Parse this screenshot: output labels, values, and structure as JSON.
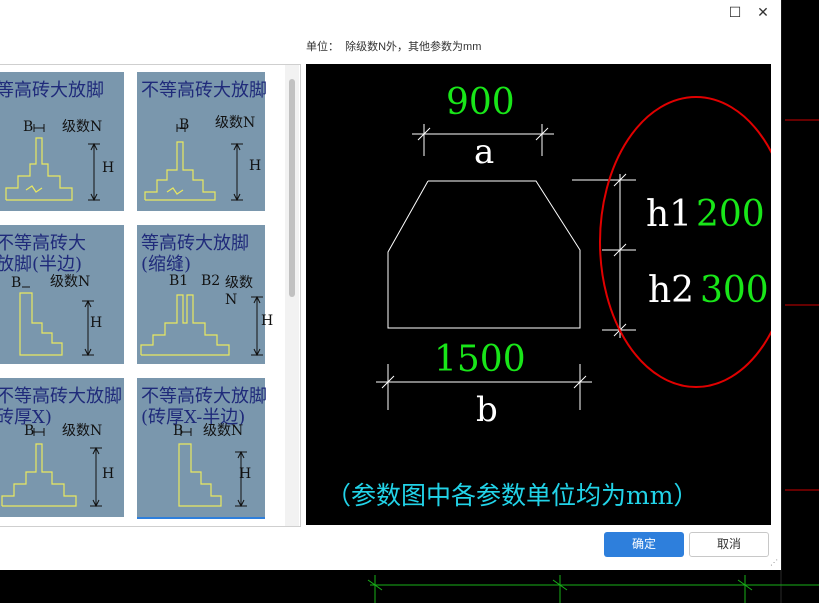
{
  "window": {
    "maximize_glyph": "☐",
    "close_glyph": "✕"
  },
  "unit_label": "单位：  除级数N外，其他参数为mm",
  "gallery": {
    "tiles": [
      {
        "title": "等高砖大放脚"
      },
      {
        "title": "不等高砖大放脚"
      },
      {
        "title": "不等高砖大\n放脚(半边)"
      },
      {
        "title": "等高砖大放脚\n(缩缝)"
      },
      {
        "title": "不等高砖大放脚\n砖厚X)"
      },
      {
        "title": "不等高砖大放脚\n(砖厚X-半边)"
      }
    ],
    "label_B": "B",
    "label_N": "级数N",
    "label_H": "H",
    "label_B1": "B1",
    "label_B2": "B2"
  },
  "preview": {
    "a_value": "900",
    "a_label": "a",
    "b_value": "1500",
    "b_label": "b",
    "h1_label": "h1",
    "h1_value": "200",
    "h2_label": "h2",
    "h2_value": "300",
    "note": "（参数图中各参数单位均为mm）"
  },
  "buttons": {
    "ok": "确定",
    "cancel": "取消"
  },
  "colors": {
    "value_green": "#19e619",
    "note_cyan": "#22d3e8",
    "highlight_red": "#e00000",
    "ok_blue": "#2e7fdc",
    "tile_bg": "#7a97ad",
    "tile_line": "#e9e860"
  }
}
